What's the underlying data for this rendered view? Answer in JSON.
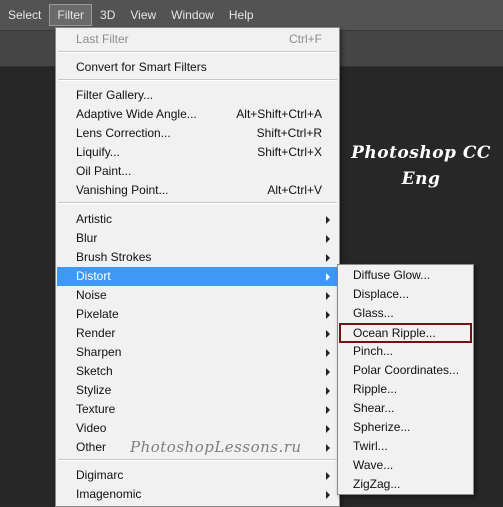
{
  "menubar": {
    "items": [
      {
        "label": "Select"
      },
      {
        "label": "Filter",
        "active": true
      },
      {
        "label": "3D"
      },
      {
        "label": "View"
      },
      {
        "label": "Window"
      },
      {
        "label": "Help"
      }
    ]
  },
  "canvas": {
    "title_line1": "Photoshop  CC",
    "title_line2": "Eng",
    "watermark": "PhotoshopLessons.ru"
  },
  "filter_menu": {
    "items": [
      {
        "label": "Last Filter",
        "shortcut": "Ctrl+F",
        "disabled": true
      },
      {
        "label": "Convert for Smart Filters"
      },
      {
        "label": "Filter Gallery..."
      },
      {
        "label": "Adaptive Wide Angle...",
        "shortcut": "Alt+Shift+Ctrl+A"
      },
      {
        "label": "Lens Correction...",
        "shortcut": "Shift+Ctrl+R"
      },
      {
        "label": "Liquify...",
        "shortcut": "Shift+Ctrl+X"
      },
      {
        "label": "Oil Paint..."
      },
      {
        "label": "Vanishing Point...",
        "shortcut": "Alt+Ctrl+V"
      },
      {
        "label": "Artistic",
        "submenu": true
      },
      {
        "label": "Blur",
        "submenu": true
      },
      {
        "label": "Brush Strokes",
        "submenu": true
      },
      {
        "label": "Distort",
        "submenu": true,
        "highlighted": true
      },
      {
        "label": "Noise",
        "submenu": true
      },
      {
        "label": "Pixelate",
        "submenu": true
      },
      {
        "label": "Render",
        "submenu": true
      },
      {
        "label": "Sharpen",
        "submenu": true
      },
      {
        "label": "Sketch",
        "submenu": true
      },
      {
        "label": "Stylize",
        "submenu": true
      },
      {
        "label": "Texture",
        "submenu": true
      },
      {
        "label": "Video",
        "submenu": true
      },
      {
        "label": "Other",
        "submenu": true
      },
      {
        "label": "Digimarc",
        "submenu": true
      },
      {
        "label": "Imagenomic",
        "submenu": true
      }
    ]
  },
  "distort_submenu": {
    "items": [
      {
        "label": "Diffuse Glow..."
      },
      {
        "label": "Displace..."
      },
      {
        "label": "Glass..."
      },
      {
        "label": "Ocean Ripple...",
        "outlined": true
      },
      {
        "label": "Pinch..."
      },
      {
        "label": "Polar Coordinates..."
      },
      {
        "label": "Ripple..."
      },
      {
        "label": "Shear..."
      },
      {
        "label": "Spherize..."
      },
      {
        "label": "Twirl..."
      },
      {
        "label": "Wave..."
      },
      {
        "label": "ZigZag..."
      }
    ]
  },
  "colors": {
    "highlight": "#3e98f5",
    "outline": "#6e1414",
    "menu_bg": "#f1f1f1"
  }
}
